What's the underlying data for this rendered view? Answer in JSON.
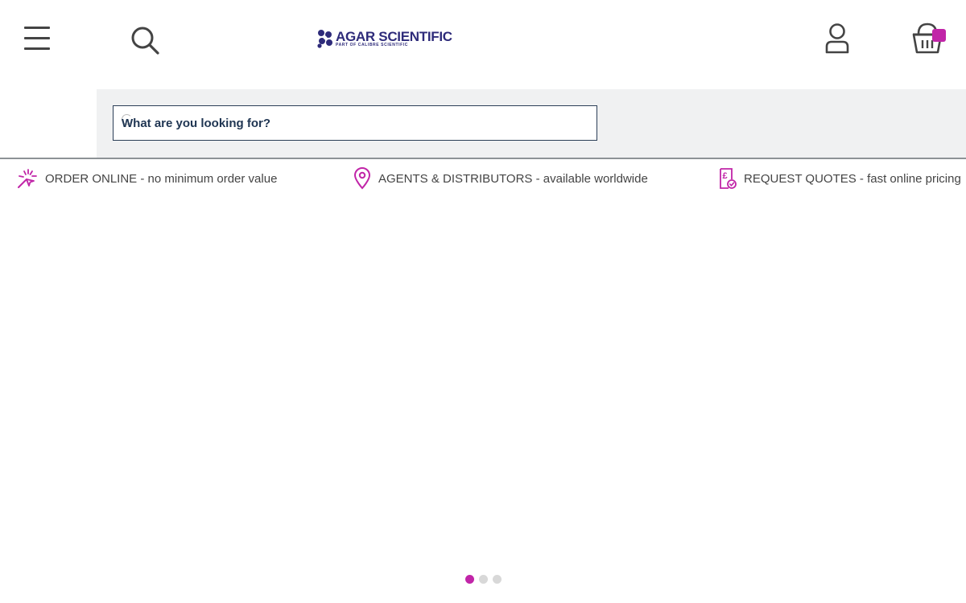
{
  "header": {
    "logo": {
      "name": "AGAR SCIENTIFIC",
      "tagline": "PART OF CALIBRE SCIENTIFIC"
    },
    "icons": {
      "menu": "hamburger-menu-icon",
      "search": "search-icon",
      "account": "user-icon",
      "basket": "basket-icon"
    },
    "basket_count": ""
  },
  "search": {
    "placeholder": "What are you looking for?",
    "value": ""
  },
  "usp_bar": [
    {
      "icon": "sparkle-click-icon",
      "title": "ORDER ONLINE",
      "subtitle": "- no minimum order value"
    },
    {
      "icon": "location-pin-icon",
      "title": "AGENTS & DISTRIBUTORS",
      "subtitle": "- available worldwide"
    },
    {
      "icon": "pound-quote-icon",
      "title": "REQUEST QUOTES",
      "subtitle": "- fast online pricing"
    }
  ],
  "carousel": {
    "slide_count": 3,
    "active_index": 0
  },
  "colors": {
    "accent": "#c125a8",
    "brand": "#2e2b7a",
    "search_text": "#1f3552",
    "panel_bg": "#f0f1f2",
    "divider": "#8d9296"
  }
}
